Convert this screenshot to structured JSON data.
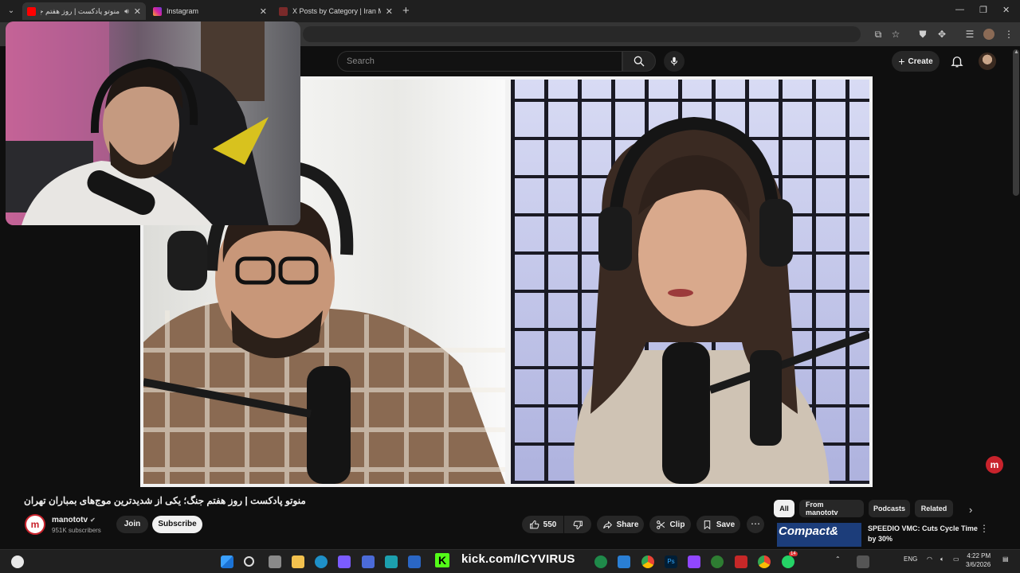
{
  "browser": {
    "tabs": [
      {
        "label": "منوتو پادکست | روز هفتم جنگ",
        "favicon_color": "#ff0000"
      },
      {
        "label": "Instagram",
        "favicon_color": "#d6249f"
      },
      {
        "label": "X Posts by Category | Iran Moni",
        "favicon_color": "#c0392b"
      }
    ]
  },
  "youtube": {
    "search_placeholder": "Search",
    "create_label": "Create",
    "video_title": "منوتو پادکست | روز هفتم جنگ؛ یکی از شدیدترین موج‌های بمباران تهران",
    "channel": {
      "name": "manototv",
      "subscribers": "951K subscribers",
      "avatar_letter": "m",
      "join_label": "Join",
      "subscribe_label": "Subscribe"
    },
    "actions": {
      "likes": "550",
      "share": "Share",
      "clip": "Clip",
      "save": "Save"
    },
    "chips": [
      "All",
      "From manototv",
      "Podcasts",
      "Related"
    ],
    "suggestion": {
      "thumb_text": "Compact&",
      "title": "SPEEDIO VMC: Cuts Cycle Time by 30%"
    },
    "floating_badge": "m"
  },
  "taskbar": {
    "kick_text": "kick.com/ICYVIRUS",
    "lang": "ENG",
    "time": "4:22 PM",
    "date": "3/6/2026",
    "whatsapp_badge": "14"
  }
}
